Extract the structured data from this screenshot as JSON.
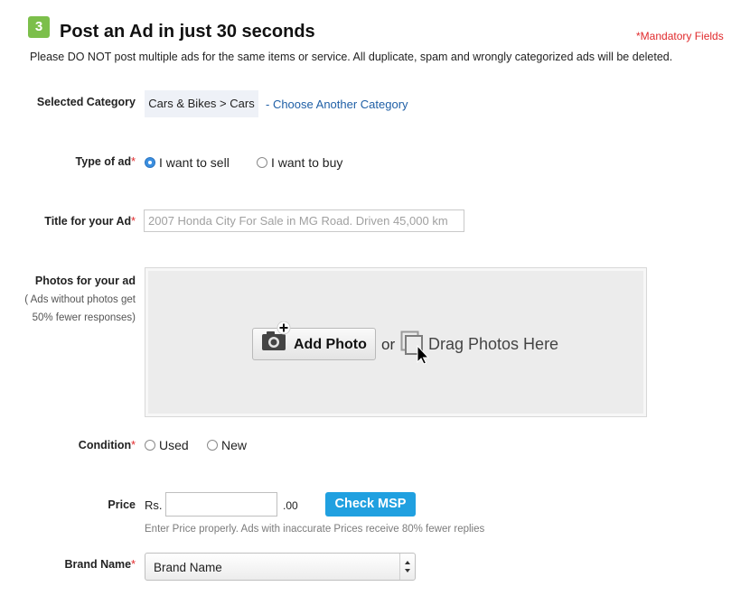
{
  "header": {
    "step_number": "3",
    "title": "Post an Ad in just 30 seconds",
    "mandatory_note": "*Mandatory Fields",
    "notice": "Please DO NOT post multiple ads for the same items or service. All duplicate, spam and wrongly categorized ads will be deleted."
  },
  "category": {
    "label": "Selected Category",
    "value": "Cars & Bikes > Cars",
    "change_link": "- Choose Another Category"
  },
  "ad_type": {
    "label": "Type of ad",
    "required_mark": "*",
    "options": [
      {
        "label": "I want to sell",
        "checked": true
      },
      {
        "label": "I want to buy",
        "checked": false
      }
    ]
  },
  "title_field": {
    "label": "Title for your Ad",
    "required_mark": "*",
    "placeholder": "2007 Honda City For Sale in MG Road. Driven 45,000 km",
    "value": ""
  },
  "photos": {
    "label": "Photos for your ad",
    "note_line1": "( Ads without photos get",
    "note_line2": "50% fewer responses)",
    "add_button": "Add Photo",
    "or_text": "or",
    "drag_text": "Drag Photos Here"
  },
  "condition": {
    "label": "Condition",
    "required_mark": "*",
    "options": [
      {
        "label": "Used",
        "checked": false
      },
      {
        "label": "New",
        "checked": false
      }
    ]
  },
  "price": {
    "label": "Price",
    "prefix": "Rs.",
    "value": "",
    "suffix": ".00",
    "button": "Check MSP",
    "hint": "Enter Price properly. Ads with inaccurate Prices receive 80% fewer replies"
  },
  "brand": {
    "label": "Brand Name",
    "required_mark": "*",
    "selected": "Brand Name"
  },
  "colors": {
    "accent_green": "#7cbf4b",
    "required_red": "#e0292b",
    "link_blue": "#1f5fa6",
    "button_blue": "#20a0e0"
  }
}
